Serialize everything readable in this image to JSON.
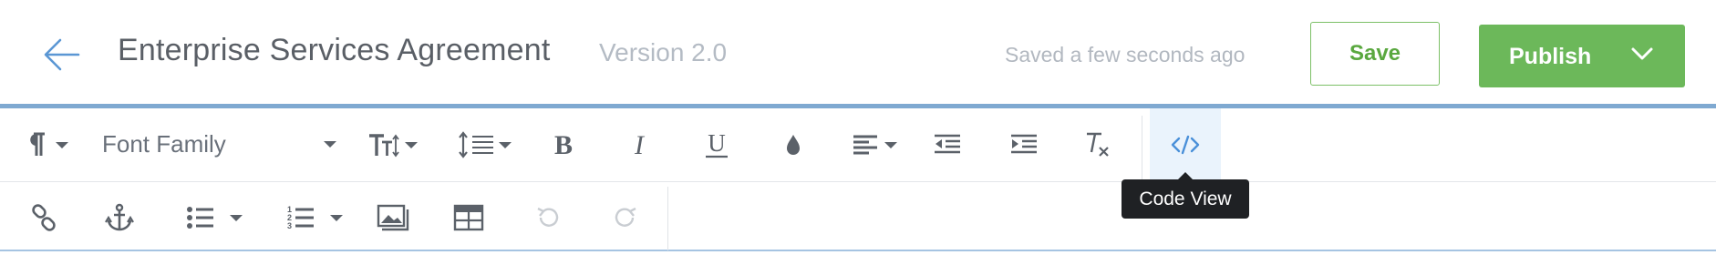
{
  "header": {
    "back_icon": "arrow-left-icon",
    "title": "Enterprise Services Agreement",
    "version": "Version 2.0",
    "save_status": "Saved a few seconds ago",
    "save_label": "Save",
    "publish_label": "Publish",
    "publish_menu_icon": "chevron-down-icon"
  },
  "toolbar": {
    "row1": [
      "paragraph-format-icon",
      "font-family-dropdown",
      "font-size-icon",
      "line-height-icon",
      "bold-icon",
      "italic-icon",
      "underline-icon",
      "text-color-icon",
      "align-icon",
      "outdent-icon",
      "indent-icon",
      "clear-formatting-icon",
      "code-view-icon"
    ],
    "font_family_label": "Font Family",
    "row2": [
      "link-icon",
      "anchor-icon",
      "bullet-list-icon",
      "numbered-list-icon",
      "insert-image-icon",
      "insert-table-icon",
      "undo-icon",
      "redo-icon"
    ],
    "active_button": "code-view",
    "tooltip": "Code View"
  },
  "colors": {
    "accent_blue": "#4a90d9",
    "publish_green": "#6cb85a",
    "save_green": "#5aa83f",
    "toolbar_border": "#7fa9d1",
    "tooltip_bg": "#1f2124"
  }
}
